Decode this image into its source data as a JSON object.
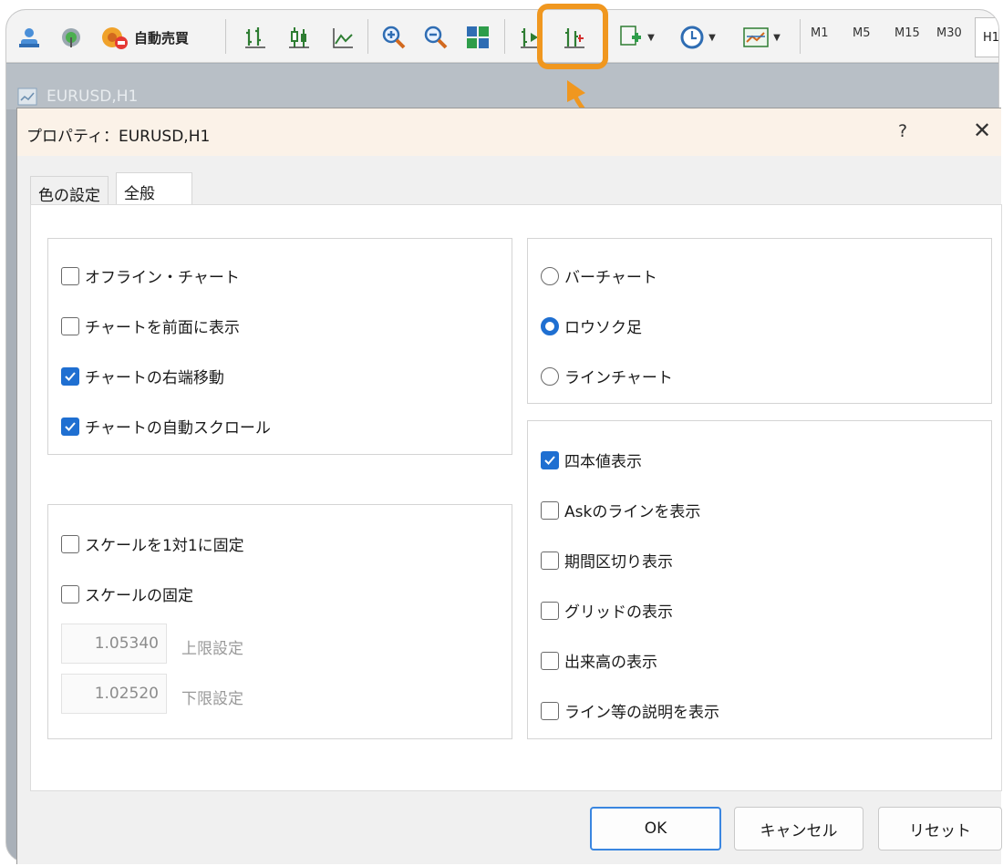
{
  "toolbar": {
    "auto_trade_label": "自動売買",
    "timeframes": [
      "M1",
      "M5",
      "M15",
      "M30"
    ],
    "active_timeframe": "H1"
  },
  "chart_window": {
    "title": "EURUSD,H1"
  },
  "dialog": {
    "title": "プロパティ：EURUSD,H1",
    "help": "?",
    "close": "✕",
    "tabs": [
      "色の設定",
      "全般"
    ],
    "group_display": {
      "options": [
        {
          "label": "オフライン・チャート",
          "checked": false
        },
        {
          "label": "チャートを前面に表示",
          "checked": false
        },
        {
          "label": "チャートの右端移動",
          "checked": true
        },
        {
          "label": "チャートの自動スクロール",
          "checked": true
        }
      ]
    },
    "group_scale": {
      "options": [
        {
          "label": "スケールを1対1に固定",
          "checked": false
        },
        {
          "label": "スケールの固定",
          "checked": false
        }
      ],
      "upper_value": "1.05340",
      "upper_label": "上限設定",
      "lower_value": "1.02520",
      "lower_label": "下限設定"
    },
    "group_chart_type": {
      "options": [
        {
          "label": "バーチャート",
          "checked": false
        },
        {
          "label": "ロウソク足",
          "checked": true
        },
        {
          "label": "ラインチャート",
          "checked": false
        }
      ]
    },
    "group_show": {
      "options": [
        {
          "label": "四本値表示",
          "checked": true
        },
        {
          "label": "Askのラインを表示",
          "checked": false
        },
        {
          "label": "期間区切り表示",
          "checked": false
        },
        {
          "label": "グリッドの表示",
          "checked": false
        },
        {
          "label": "出来高の表示",
          "checked": false
        },
        {
          "label": "ライン等の説明を表示",
          "checked": false
        }
      ]
    },
    "buttons": {
      "ok": "OK",
      "cancel": "キャンセル",
      "reset": "リセット"
    }
  },
  "colors": {
    "accent_highlight": "#f0971f",
    "check_blue": "#1f6fd1"
  }
}
